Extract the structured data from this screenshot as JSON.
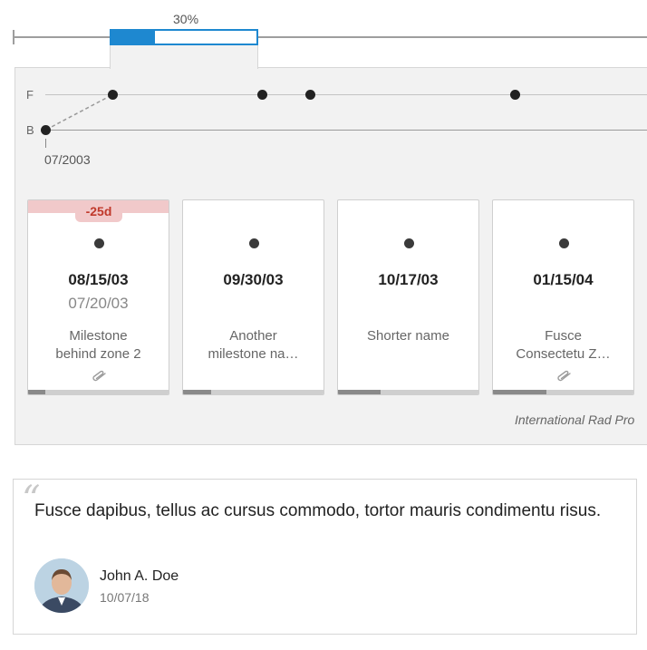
{
  "progress": {
    "label": "30%",
    "value": 0.3
  },
  "timeline": {
    "lanes": {
      "forecast_label": "F",
      "baseline_label": "B"
    },
    "start_date": "07/2003"
  },
  "milestones": [
    {
      "date": "08/15/03",
      "original_date": "07/20/03",
      "name_line1": "Milestone",
      "name_line2": "behind zone 2",
      "late_badge": "-25d",
      "has_attachment": true,
      "progress": 0.12
    },
    {
      "date": "09/30/03",
      "name_line1": "Another",
      "name_line2": "milestone na…",
      "has_attachment": false,
      "progress": 0.2
    },
    {
      "date": "10/17/03",
      "name_line1": "Shorter name",
      "has_attachment": false,
      "progress": 0.3
    },
    {
      "date": "01/15/04",
      "name_line1": "Fusce",
      "name_line2": "Consectetu Z…",
      "has_attachment": true,
      "progress": 0.38
    }
  ],
  "project_caption": "International Rad Pro",
  "quote": {
    "text": "Fusce dapibus, tellus ac cursus commodo, tortor mauris condimentu risus.",
    "author": "John A. Doe",
    "date": "10/07/18"
  },
  "colors": {
    "accent": "#1e88d0",
    "late": "#c0392b",
    "late_bg": "#f1c9ca"
  }
}
